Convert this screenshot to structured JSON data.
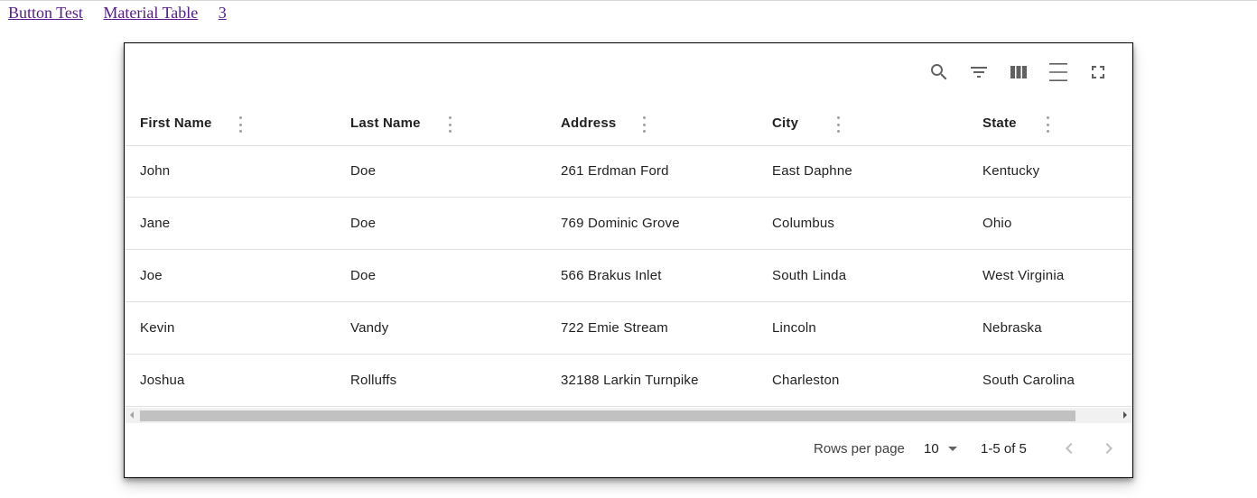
{
  "nav": {
    "links": [
      "Button Test",
      "Material Table",
      "3"
    ]
  },
  "toolbar": {
    "icons": [
      "search-icon",
      "filter-icon",
      "columns-icon",
      "density-icon",
      "fullscreen-icon"
    ],
    "icon_color": "#616161"
  },
  "table": {
    "columns": [
      "First Name",
      "Last Name",
      "Address",
      "City",
      "State"
    ],
    "rows": [
      [
        "John",
        "Doe",
        "261 Erdman Ford",
        "East Daphne",
        "Kentucky"
      ],
      [
        "Jane",
        "Doe",
        "769 Dominic Grove",
        "Columbus",
        "Ohio"
      ],
      [
        "Joe",
        "Doe",
        "566 Brakus Inlet",
        "South Linda",
        "West Virginia"
      ],
      [
        "Kevin",
        "Vandy",
        "722 Emie Stream",
        "Lincoln",
        "Nebraska"
      ],
      [
        "Joshua",
        "Rolluffs",
        "32188 Larkin Turnpike",
        "Charleston",
        "South Carolina"
      ]
    ]
  },
  "pagination": {
    "rows_per_page_label": "Rows per page",
    "rows_per_page_value": "10",
    "range_text": "1-5 of 5"
  },
  "colors": {
    "link": "#551a8b",
    "divider": "#e0e0e0",
    "text": "#212121"
  }
}
